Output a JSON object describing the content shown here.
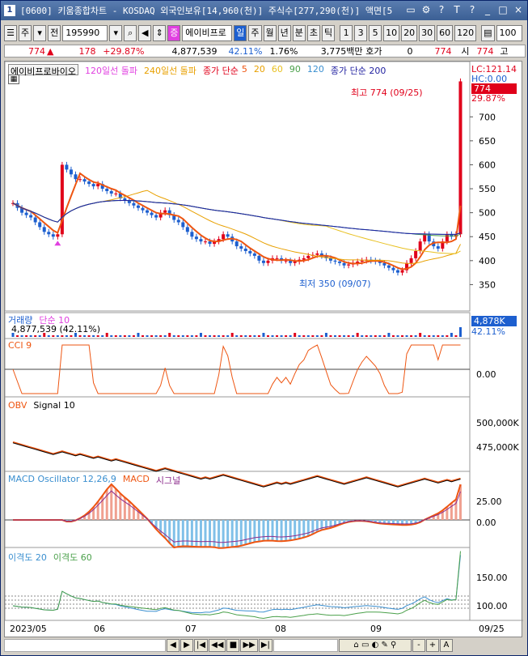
{
  "window": {
    "title": "[0600] 키움종합차트 - KOSDAQ 외국인보유[14,960(천)] 주식수[277,290(천)] 액면[5",
    "app_icon": "1",
    "buttons": [
      "▭",
      "⚙",
      "?",
      "T",
      "?",
      "_",
      "□",
      "×"
    ]
  },
  "toolbar": {
    "market": "주",
    "market_btn": "▾",
    "type": "전",
    "code": "195990",
    "name": "에이비프로",
    "periods": [
      "일",
      "주",
      "월",
      "년",
      "분",
      "초",
      "틱"
    ],
    "active_period": "일",
    "intervals": [
      "1",
      "3",
      "5",
      "10",
      "20",
      "30",
      "60",
      "120"
    ],
    "count": "100"
  },
  "quote": {
    "price": "774",
    "change": "178",
    "change_pct": "+29.87%",
    "volume": "4,877,539",
    "vol_ratio": "42.11%",
    "turnover": "1.76%",
    "amount": "3,775백만",
    "hoga_label": "호가",
    "hoga": "0",
    "last": "774",
    "si_label": "시",
    "si": "774",
    "go_label": "고"
  },
  "legend": {
    "name": "에이비프로바이오",
    "ma120_break": "120일선 돌파",
    "ma240_break": "240일선 돌파",
    "ma_label": "종가 단순",
    "ma_periods": [
      "5",
      "20",
      "60",
      "90",
      "120"
    ],
    "ma200_label": "종가 단순 200",
    "lc": "LC:121.14",
    "hc": "HC:0.00",
    "price_tag": "774",
    "pct_tag": "29.87%"
  },
  "colors": {
    "ma5": "#ee5511",
    "ma20": "#e8a000",
    "ma60": "#e8c020",
    "ma90": "#4aa04a",
    "ma120": "#3a8fd0",
    "ma200": "#1f1f9f",
    "up": "#e0001a",
    "down": "#1d5fcf",
    "accent_pink": "#e040e0"
  },
  "annotations": {
    "high": "최고 774 (09/25)",
    "low": "최저 350 (09/07)"
  },
  "volume_panel": {
    "title": "거래량",
    "ma_label": "단순 10",
    "value": "4,877,539 (42.11%)",
    "axis_tag": "4,878K",
    "axis_tag2": "42.11%"
  },
  "cci_panel": {
    "title": "CCI 9",
    "zero": "0.00"
  },
  "obv_panel": {
    "title": "OBV",
    "signal": "Signal 10",
    "ticks": [
      "500,000K",
      "475,000K"
    ]
  },
  "macd_panel": {
    "title": "MACD Oscillator 12,26,9",
    "macd": "MACD",
    "signal": "시그널",
    "ticks": [
      "25.00",
      "0.00"
    ]
  },
  "disparity_panel": {
    "title": "이격도 20",
    "title2": "이격도 60",
    "ticks": [
      "150.00",
      "100.00"
    ]
  },
  "xaxis": {
    "labels": [
      "2023/05",
      "06",
      "07",
      "08",
      "09"
    ],
    "right_label": "09/25"
  },
  "bottom_bar": [
    "◀",
    "▶",
    "|◀",
    "◀◀",
    "■",
    "▶▶",
    "▶|",
    "-",
    "+",
    "A"
  ],
  "chart_data": {
    "type": "line",
    "title": "에이비프로바이오",
    "x": [
      "2023/05",
      "06",
      "07",
      "08",
      "09",
      "09/25"
    ],
    "y_ticks": [
      350,
      400,
      450,
      500,
      550,
      600,
      650,
      700
    ],
    "ylim": [
      300,
      790
    ],
    "close": [
      520,
      510,
      500,
      495,
      490,
      480,
      470,
      460,
      455,
      450,
      455,
      600,
      590,
      580,
      570,
      570,
      565,
      560,
      555,
      560,
      550,
      545,
      540,
      540,
      530,
      525,
      520,
      515,
      510,
      505,
      500,
      495,
      490,
      500,
      505,
      495,
      485,
      480,
      470,
      460,
      450,
      445,
      440,
      440,
      435,
      440,
      445,
      455,
      450,
      440,
      430,
      425,
      420,
      415,
      410,
      400,
      395,
      400,
      405,
      405,
      400,
      400,
      395,
      398,
      402,
      405,
      410,
      412,
      415,
      410,
      405,
      400,
      398,
      395,
      390,
      392,
      395,
      398,
      400,
      402,
      400,
      398,
      395,
      390,
      385,
      380,
      375,
      380,
      395,
      405,
      420,
      440,
      455,
      440,
      430,
      425,
      440,
      455,
      450,
      455,
      774
    ],
    "high_label": 774,
    "low_label": 350,
    "volume_k_last": 4878
  }
}
